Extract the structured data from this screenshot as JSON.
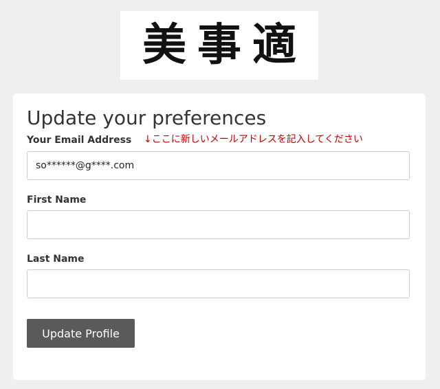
{
  "logo": {
    "text": "美事適"
  },
  "form": {
    "title": "Update your preferences",
    "email": {
      "label": "Your Email Address",
      "note": "↓ここに新しいメールアドレスを記入してください",
      "value": "so******@g****.com",
      "placeholder": ""
    },
    "first_name": {
      "label": "First Name",
      "value": "",
      "placeholder": ""
    },
    "last_name": {
      "label": "Last Name",
      "value": "",
      "placeholder": ""
    },
    "submit_label": "Update Profile"
  },
  "colors": {
    "page_background": "#efefef",
    "card_background": "#ffffff",
    "note_text": "#c00000",
    "button_background": "#5a5a5a",
    "button_text": "#ffffff"
  }
}
